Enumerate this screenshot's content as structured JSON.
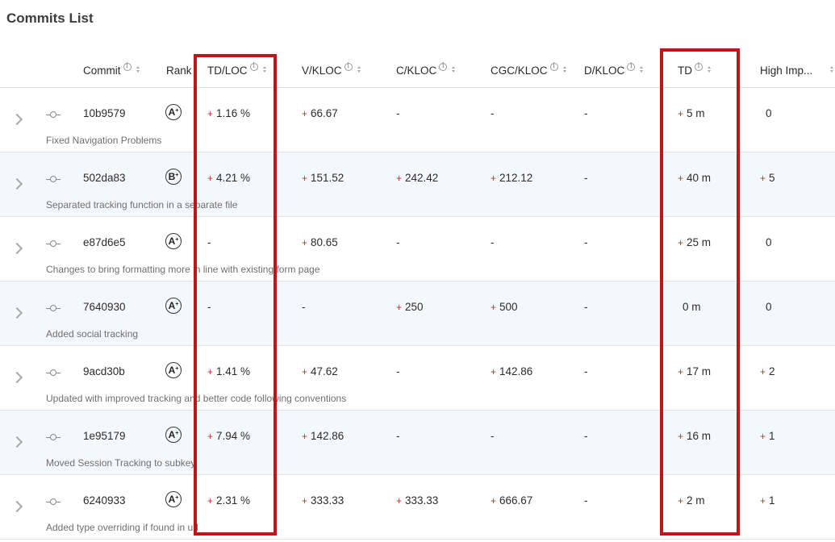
{
  "title": "Commits List",
  "columns": {
    "commit": "Commit",
    "rank": "Rank",
    "td_loc": "TD/LOC",
    "v_kloc": "V/KLOC",
    "c_kloc": "C/KLOC",
    "cgc_kloc": "CGC/KLOC",
    "d_kloc": "D/KLOC",
    "td": "TD",
    "high_imp": "High Imp..."
  },
  "plus_sign": "+",
  "rows": [
    {
      "hash": "10b9579",
      "rank": "A",
      "rank_sup": "+",
      "td_loc": "1.16 %",
      "td_loc_plus": "+",
      "v_kloc": "66.67",
      "v_plus": "+",
      "c_kloc": "-",
      "c_plus": "",
      "cgc_kloc": "-",
      "cgc_plus": "",
      "d_kloc": "-",
      "td": "5 m",
      "td_plus": "+",
      "high_imp": "0",
      "hi_plus": "",
      "desc": "Fixed Navigation Problems"
    },
    {
      "hash": "502da83",
      "rank": "B",
      "rank_sup": "+",
      "td_loc": "4.21 %",
      "td_loc_plus": "+",
      "v_kloc": "151.52",
      "v_plus": "+",
      "c_kloc": "242.42",
      "c_plus": "+",
      "cgc_kloc": "212.12",
      "cgc_plus": "+",
      "d_kloc": "-",
      "td": "40 m",
      "td_plus": "+",
      "high_imp": "5",
      "hi_plus": "+",
      "desc": "Separated tracking function in a separate file"
    },
    {
      "hash": "e87d6e5",
      "rank": "A",
      "rank_sup": "+",
      "td_loc": "-",
      "td_loc_plus": "",
      "v_kloc": "80.65",
      "v_plus": "+",
      "c_kloc": "-",
      "c_plus": "",
      "cgc_kloc": "-",
      "cgc_plus": "",
      "d_kloc": "-",
      "td": "25 m",
      "td_plus": "+",
      "high_imp": "0",
      "hi_plus": "",
      "desc": "Changes to bring formatting more in line with existing form page"
    },
    {
      "hash": "7640930",
      "rank": "A",
      "rank_sup": "+",
      "td_loc": "-",
      "td_loc_plus": "",
      "v_kloc": "-",
      "v_plus": "",
      "c_kloc": "250",
      "c_plus": "+",
      "cgc_kloc": "500",
      "cgc_plus": "+",
      "d_kloc": "-",
      "td": "0 m",
      "td_plus": "",
      "high_imp": "0",
      "hi_plus": "",
      "desc": "Added social tracking"
    },
    {
      "hash": "9acd30b",
      "rank": "A",
      "rank_sup": "+",
      "td_loc": "1.41 %",
      "td_loc_plus": "+",
      "v_kloc": "47.62",
      "v_plus": "+",
      "c_kloc": "-",
      "c_plus": "",
      "cgc_kloc": "142.86",
      "cgc_plus": "+",
      "d_kloc": "-",
      "td": "17 m",
      "td_plus": "+",
      "high_imp": "2",
      "hi_plus": "+",
      "desc": "Updated with improved tracking and better code following conventions"
    },
    {
      "hash": "1e95179",
      "rank": "A",
      "rank_sup": "+",
      "td_loc": "7.94 %",
      "td_loc_plus": "+",
      "v_kloc": "142.86",
      "v_plus": "+",
      "c_kloc": "-",
      "c_plus": "",
      "cgc_kloc": "-",
      "cgc_plus": "",
      "d_kloc": "-",
      "td": "16 m",
      "td_plus": "+",
      "high_imp": "1",
      "hi_plus": "+",
      "desc": "Moved Session Tracking to subkey"
    },
    {
      "hash": "6240933",
      "rank": "A",
      "rank_sup": "+",
      "td_loc": "2.31 %",
      "td_loc_plus": "+",
      "v_kloc": "333.33",
      "v_plus": "+",
      "c_kloc": "333.33",
      "c_plus": "+",
      "cgc_kloc": "666.67",
      "cgc_plus": "+",
      "d_kloc": "-",
      "td": "2 m",
      "td_plus": "+",
      "high_imp": "1",
      "hi_plus": "+",
      "desc": "Added type overriding if found in url"
    }
  ],
  "colors": {
    "highlight": "#c0141b",
    "plus": "#c03030",
    "alt_row": "#f3f8fc"
  }
}
